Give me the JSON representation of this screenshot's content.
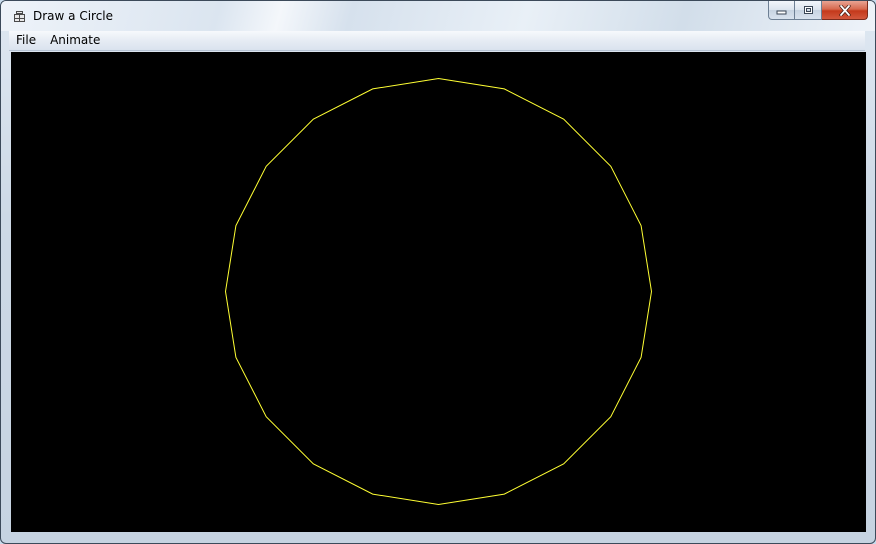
{
  "window": {
    "title": "Draw a Circle",
    "icon": "app-window-icon"
  },
  "caption_buttons": {
    "minimize_icon": "minimize-icon",
    "maximize_icon": "restore-icon",
    "close_icon": "close-icon"
  },
  "menu": {
    "items": [
      {
        "label": "File"
      },
      {
        "label": "Animate"
      }
    ]
  },
  "canvas": {
    "background_color": "#000000",
    "stroke_color": "#ffff33",
    "shape": "polygon",
    "sides": 20
  }
}
